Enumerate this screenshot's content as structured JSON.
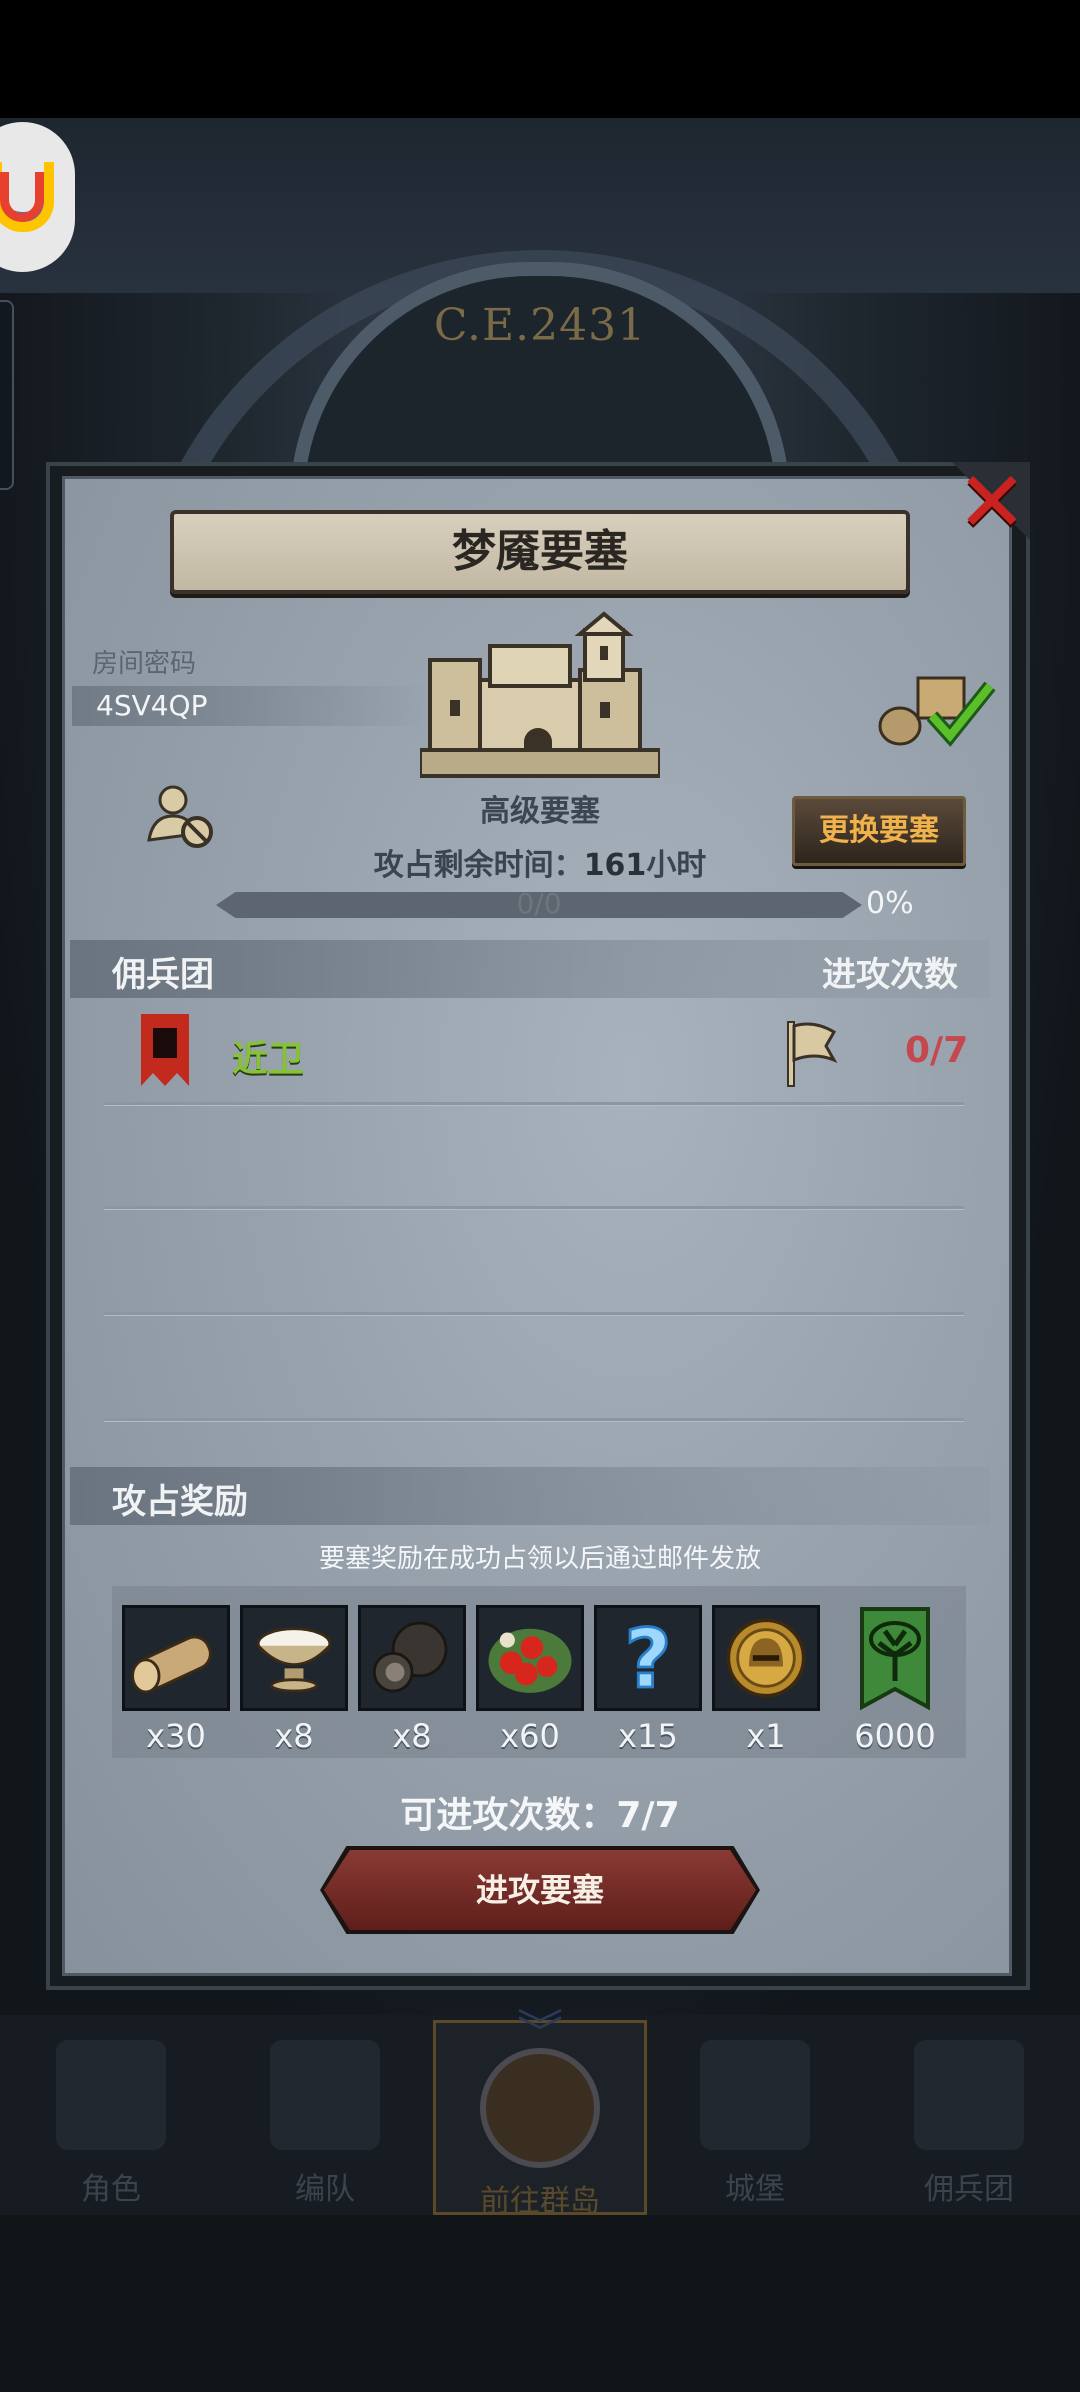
{
  "background": {
    "era": "C.E.2431",
    "nav": [
      {
        "label": "角色",
        "icon": "knight-icon"
      },
      {
        "label": "编队",
        "icon": "helmet-icon"
      },
      {
        "label": "前往群岛",
        "icon": "island-compass-icon"
      },
      {
        "label": "城堡",
        "icon": "castle-icon"
      },
      {
        "label": "佣兵团",
        "icon": "mercenary-icon"
      }
    ]
  },
  "modal": {
    "title": "梦魇要塞",
    "room_password_label": "房间密码",
    "room_password": "4SV4QP",
    "fortress_type": "高级要塞",
    "change_button": "更换要塞",
    "occupy_time_label": "攻占剩余时间：",
    "occupy_time_value": "161",
    "occupy_time_unit": "小时",
    "progress_text": "0/0",
    "progress_percent": "0%",
    "progress_fraction": 0,
    "mercenary_header": "佣兵团",
    "attack_count_header": "进攻次数",
    "mercenaries": [
      {
        "name": "近卫",
        "attacks": "0/7",
        "name_color": "#86c13a",
        "attacks_color": "#c4484e"
      }
    ],
    "rewards_header": "攻占奖励",
    "rewards_note": "要塞奖励在成功占领以后通过邮件发放",
    "rewards": [
      {
        "icon": "wood-log-icon",
        "amount": "x30"
      },
      {
        "icon": "milk-bowl-icon",
        "amount": "x8"
      },
      {
        "icon": "truffle-icon",
        "amount": "x8"
      },
      {
        "icon": "berries-icon",
        "amount": "x60"
      },
      {
        "icon": "blue-question-mark-icon",
        "amount": "x15"
      },
      {
        "icon": "helmet-medal-icon",
        "amount": "x1"
      },
      {
        "icon": "green-tree-banner-icon",
        "amount": "6000"
      }
    ],
    "available_attacks_label": "可进攻次数：",
    "available_attacks_value": "7/7",
    "attack_button": "进攻要塞"
  }
}
